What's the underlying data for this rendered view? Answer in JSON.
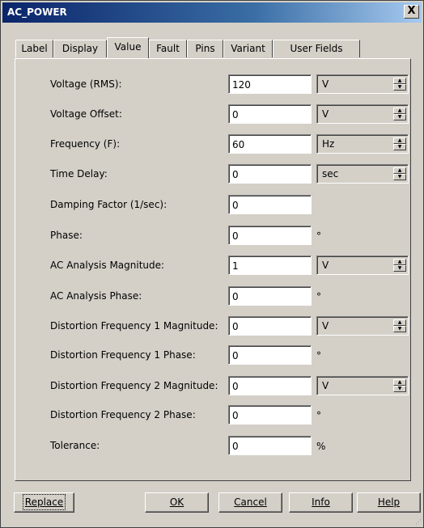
{
  "window": {
    "title": "AC_POWER",
    "close_label": "X"
  },
  "tabs": [
    {
      "label": "Label"
    },
    {
      "label": "Display"
    },
    {
      "label": "Value"
    },
    {
      "label": "Fault"
    },
    {
      "label": "Pins"
    },
    {
      "label": "Variant"
    },
    {
      "label": "User Fields"
    }
  ],
  "active_tab": "Value",
  "params": [
    {
      "label": "Voltage (RMS):",
      "value": "120",
      "unit": "V"
    },
    {
      "label": "Voltage Offset:",
      "value": "0",
      "unit": "V"
    },
    {
      "label": "Frequency (F):",
      "value": "60",
      "unit": "Hz"
    },
    {
      "label": "Time Delay:",
      "value": "0",
      "unit": "sec"
    },
    {
      "label": "Damping Factor (1/sec):",
      "value": "0",
      "unit": ""
    },
    {
      "label": "Phase:",
      "value": "0",
      "unit": "°"
    },
    {
      "label": "AC Analysis Magnitude:",
      "value": "1",
      "unit": "V"
    },
    {
      "label": "AC Analysis Phase:",
      "value": "0",
      "unit": "°"
    },
    {
      "label": "Distortion Frequency 1 Magnitude:",
      "value": "0",
      "unit": "V"
    },
    {
      "label": "Distortion Frequency 1 Phase:",
      "value": "0",
      "unit": "°"
    },
    {
      "label": "Distortion Frequency 2 Magnitude:",
      "value": "0",
      "unit": "V"
    },
    {
      "label": "Distortion Frequency 2 Phase:",
      "value": "0",
      "unit": "°"
    },
    {
      "label": "Tolerance:",
      "value": "0",
      "unit": "%"
    }
  ],
  "buttons": {
    "replace": "Replace",
    "ok": "OK",
    "cancel": "Cancel",
    "info": "Info",
    "help": "Help"
  },
  "colors": {
    "titlebar_start": "#0a246a",
    "titlebar_end": "#a6caf0",
    "face": "#d4d0c8"
  }
}
